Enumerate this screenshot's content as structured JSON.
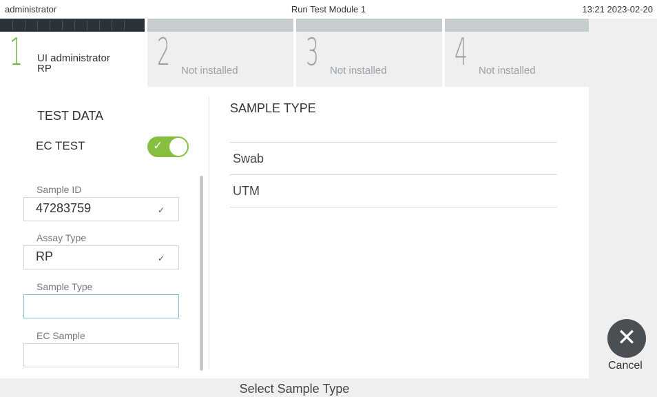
{
  "header": {
    "user": "administrator",
    "title": "Run Test Module 1",
    "clock": "13:21 2023-02-20"
  },
  "tabs": [
    {
      "number": "1",
      "line1": "UI administrator",
      "line2": "RP",
      "active": true
    },
    {
      "number": "2",
      "label": "Not installed",
      "active": false
    },
    {
      "number": "3",
      "label": "Not installed",
      "active": false
    },
    {
      "number": "4",
      "label": "Not installed",
      "active": false
    }
  ],
  "left": {
    "section_title": "TEST DATA",
    "ec_test_label": "EC TEST",
    "ec_test_on": true,
    "fields": [
      {
        "label": "Sample ID",
        "value": "47283759",
        "check": "✓"
      },
      {
        "label": "Assay Type",
        "value": "RP",
        "check": "✓"
      },
      {
        "label": "Sample Type",
        "value": ""
      },
      {
        "label": "EC Sample",
        "value": ""
      }
    ]
  },
  "right": {
    "title": "SAMPLE TYPE",
    "options": [
      "Swab",
      "UTM"
    ]
  },
  "footer": {
    "instruction": "Select Sample Type"
  },
  "cancel": {
    "label": "Cancel",
    "icon": "close-icon"
  },
  "colors": {
    "accent_green": "#86bf3f",
    "focus_border": "#7ec3cf",
    "cancel_button": "#4a4f54"
  }
}
